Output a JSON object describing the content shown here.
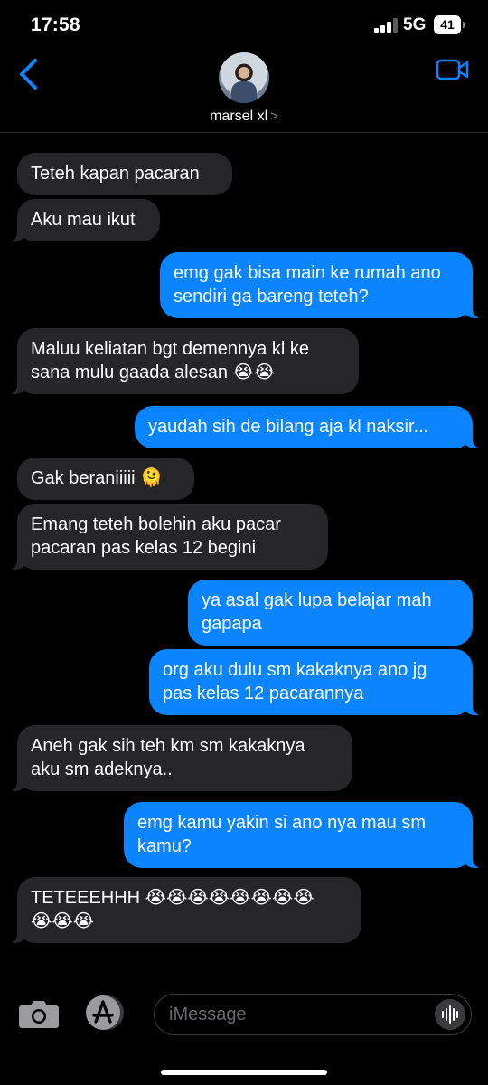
{
  "status_bar": {
    "time": "17:58",
    "network": "5G",
    "battery": "41"
  },
  "header": {
    "contact_name": "marsel xl"
  },
  "messages": [
    {
      "from": "contact",
      "text": "Teteh kapan pacaran"
    },
    {
      "from": "contact",
      "text": "Aku mau ikut"
    },
    {
      "from": "me",
      "text": "emg gak bisa main ke rumah ano\nsendiri ga bareng teteh?"
    },
    {
      "from": "contact",
      "text": "Maluu keliatan bgt demennya kl ke\nsana mulu gaada alesan 😭😭"
    },
    {
      "from": "me",
      "text": "yaudah sih de bilang aja kl naksir..."
    },
    {
      "from": "contact",
      "text": "Gak beraniiiii 🫠"
    },
    {
      "from": "contact",
      "text": "Emang teteh bolehin aku pacar\npacaran pas kelas 12 begini"
    },
    {
      "from": "me",
      "text": "ya asal gak lupa belajar mah\ngapapa"
    },
    {
      "from": "me",
      "text": "org aku dulu sm kakaknya ano jg\npas kelas 12 pacarannya"
    },
    {
      "from": "contact",
      "text": "Aneh gak sih teh km sm kakaknya\naku sm adeknya.."
    },
    {
      "from": "me",
      "text": "emg kamu yakin si ano nya mau sm\nkamu?"
    },
    {
      "from": "contact",
      "text": "TETEEEHHH 😭😭😭😭😭😭😭😭\n😭😭😭"
    }
  ],
  "input": {
    "placeholder": "iMessage"
  },
  "icons": {
    "back": "chevron-left-icon",
    "video": "video-camera-icon",
    "camera": "camera-icon",
    "apps": "app-store-icon",
    "audio": "waveform-icon"
  },
  "colors": {
    "outgoing": "#0a84ff",
    "incoming": "#262628",
    "accent": "#0a84ff"
  }
}
